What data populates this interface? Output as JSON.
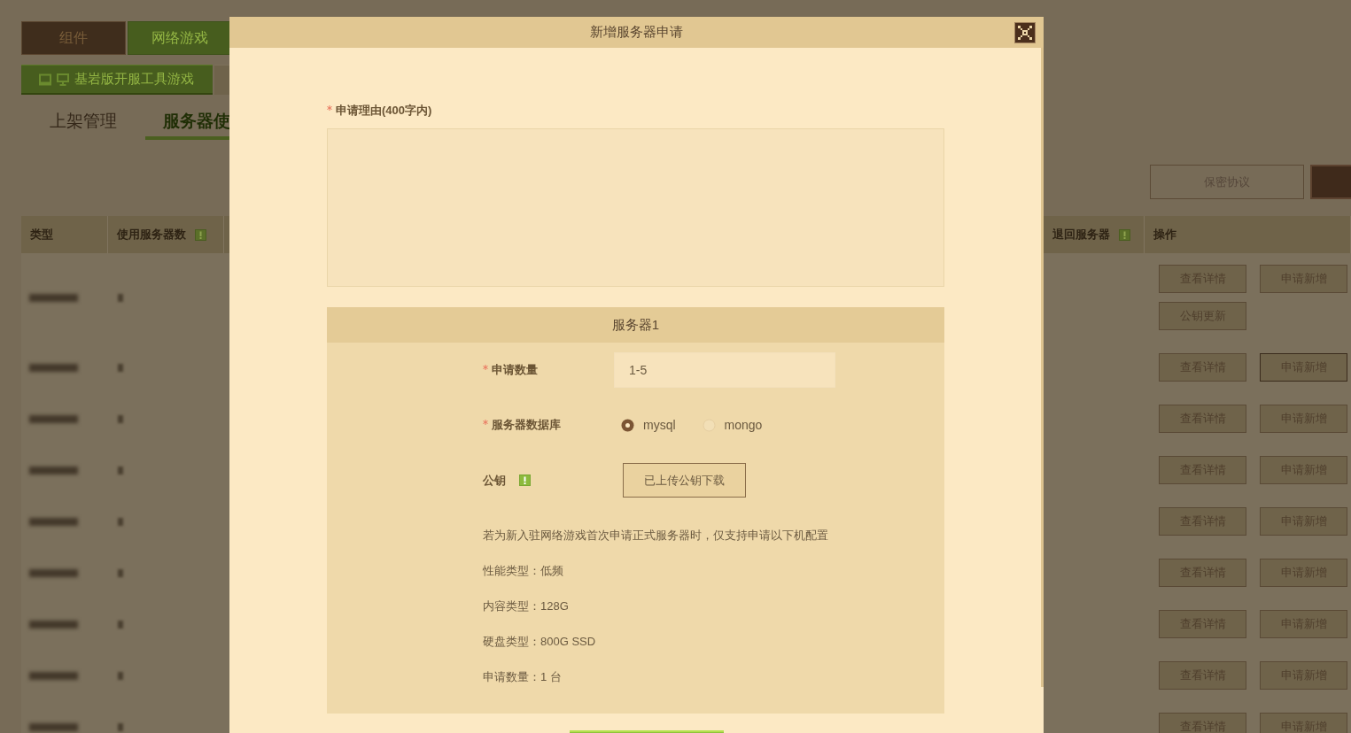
{
  "top_tabs": [
    {
      "label": "组件",
      "selected": false
    },
    {
      "label": "网络游戏",
      "selected": true
    }
  ],
  "tool_tabs": [
    {
      "label": "基岩版开服工具游戏",
      "selected": true
    },
    {
      "selected": false
    }
  ],
  "sub_tabs": [
    {
      "label": "上架管理",
      "selected": false
    },
    {
      "label": "服务器使",
      "selected": true
    }
  ],
  "toolbar_buttons": [
    {
      "label": "保密协议",
      "kind": "outline"
    },
    {
      "kind": "filled"
    }
  ],
  "table": {
    "columns": [
      {
        "label": "类型",
        "hint": false
      },
      {
        "label": "使用服务器数",
        "hint": true
      },
      {
        "label": "退回服务器",
        "hint": true
      },
      {
        "label": "操作",
        "hint": false
      }
    ],
    "rows": [
      {
        "actions": [
          {
            "label": "查看详情",
            "highlighted": false
          },
          {
            "label": "申请新增",
            "highlighted": false
          },
          {
            "label": "公钥更新",
            "highlighted": false
          }
        ]
      },
      {
        "actions": [
          {
            "label": "查看详情",
            "highlighted": false
          },
          {
            "label": "申请新增",
            "highlighted": true
          }
        ]
      },
      {
        "actions": [
          {
            "label": "查看详情",
            "highlighted": false
          },
          {
            "label": "申请新增",
            "highlighted": false
          }
        ]
      },
      {
        "actions": [
          {
            "label": "查看详情",
            "highlighted": false
          },
          {
            "label": "申请新增",
            "highlighted": false
          }
        ]
      },
      {
        "actions": [
          {
            "label": "查看详情",
            "highlighted": false
          },
          {
            "label": "申请新增",
            "highlighted": false
          }
        ]
      },
      {
        "actions": [
          {
            "label": "查看详情",
            "highlighted": false
          },
          {
            "label": "申请新增",
            "highlighted": false
          }
        ]
      },
      {
        "actions": [
          {
            "label": "查看详情",
            "highlighted": false
          },
          {
            "label": "申请新增",
            "highlighted": false
          }
        ]
      },
      {
        "actions": [
          {
            "label": "查看详情",
            "highlighted": false
          },
          {
            "label": "申请新增",
            "highlighted": false
          }
        ]
      },
      {
        "actions": [
          {
            "label": "查看详情",
            "highlighted": false
          },
          {
            "label": "申请新增",
            "highlighted": false
          }
        ]
      }
    ]
  },
  "dialog": {
    "title": "新增服务器申请",
    "reason": {
      "label": "申请理由(400字内)",
      "required": true
    },
    "servers": [
      {
        "title": "服务器1",
        "fields": [
          {
            "kind": "input",
            "label": "申请数量",
            "required": true,
            "hint": false,
            "placeholder": "1-5"
          },
          {
            "kind": "radio",
            "label": "服务器数据库",
            "required": true,
            "hint": false,
            "options": [
              {
                "label": "mysql",
                "selected": true
              },
              {
                "label": "mongo",
                "selected": false
              }
            ]
          },
          {
            "kind": "button",
            "label": "公钥",
            "required": false,
            "hint": true,
            "button": "已上传公钥下载"
          }
        ],
        "notes": [
          "若为新入驻网络游戏首次申请正式服务器时，仅支持申请以下机配置",
          "性能类型：低频",
          "内容类型：128G",
          "硬盘类型：800G SSD",
          "申请数量：1 台"
        ]
      }
    ]
  }
}
